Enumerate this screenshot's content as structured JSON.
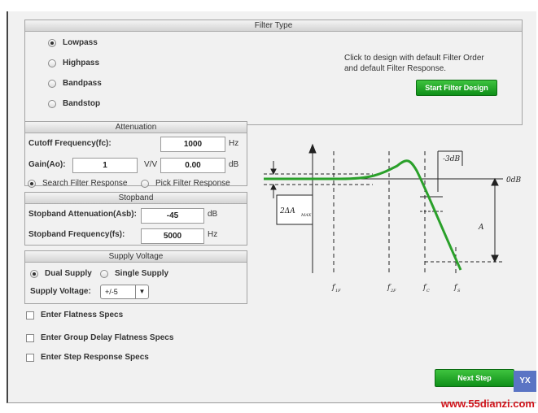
{
  "filter_type": {
    "header": "Filter Type",
    "options": [
      "Lowpass",
      "Highpass",
      "Bandpass",
      "Bandstop"
    ],
    "selected": "Lowpass",
    "hint_line1": "Click to design with default Filter Order",
    "hint_line2": "and default Filter Response.",
    "start_button": "Start Filter Design"
  },
  "attenuation": {
    "header": "Attenuation",
    "cutoff_label": "Cutoff Frequency(fc):",
    "cutoff_value": "1000",
    "cutoff_unit": "Hz",
    "gain_label": "Gain(Ao):",
    "gain_value": "1",
    "gain_unit_vv": "V/V",
    "gain_db_value": "0.00",
    "gain_unit_db": "dB"
  },
  "response_mode": {
    "search": "Search Filter Response",
    "pick": "Pick Filter Response"
  },
  "stopband": {
    "header": "Stopband",
    "atten_label": "Stopband Attenuation(Asb):",
    "atten_value": "-45",
    "atten_unit": "dB",
    "freq_label": "Stopband Frequency(fs):",
    "freq_value": "5000",
    "freq_unit": "Hz"
  },
  "supply": {
    "header": "Supply Voltage",
    "dual": "Dual Supply",
    "single": "Single Supply",
    "voltage_label": "Supply Voltage:",
    "voltage_value": "+/-5"
  },
  "specs": [
    "Enter Flatness Specs",
    "Enter Group Delay Flatness Specs",
    "Enter Step Response Specs"
  ],
  "diagram": {
    "minus3db": "-3dB",
    "zerodb": "0dB",
    "delta_amax": "2ΔA",
    "delta_amax_sub": "MAX",
    "a_label": "A",
    "f1f": "f",
    "f1f_sub": "1F",
    "f2f": "f",
    "f2f_sub": "2F",
    "fc": "f",
    "fc_sub": "C",
    "fs": "f",
    "fs_sub": "S"
  },
  "footer": {
    "next_button": "Next Step",
    "watermark": "www.55dianzi.com",
    "wm_logo": "YX"
  },
  "colors": {
    "accent_green": "#1fa52a",
    "curve_green": "#2aa02a"
  }
}
